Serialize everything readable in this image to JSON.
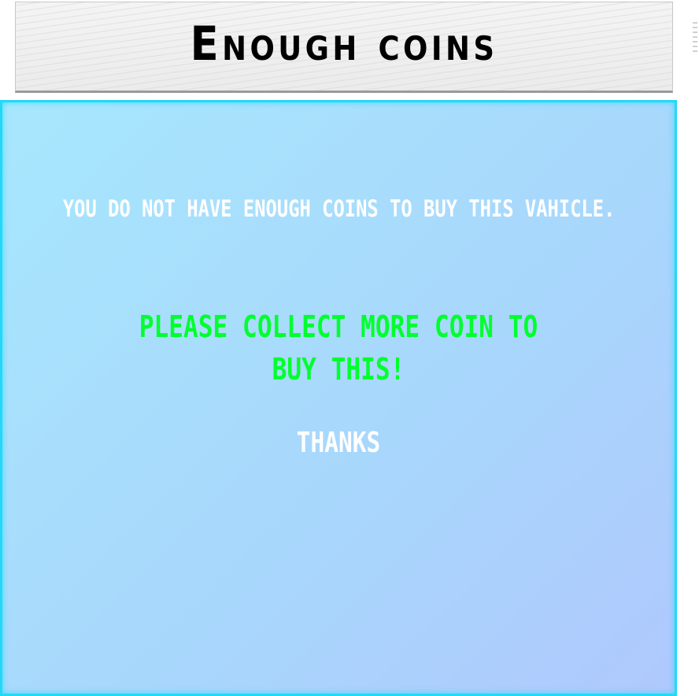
{
  "header": {
    "title": "Enough coins"
  },
  "dialog": {
    "message": "YOU DO NOT HAVE ENOUGH COINS TO BUY THIS VAHICLE.",
    "please_line1": "PLEASE COLLECT MORE COIN TO",
    "please_line2": "BUY THIS!",
    "thanks": "THANKS"
  },
  "colors": {
    "header_text": "#000000",
    "panel_border": "#22d8f8",
    "message_text": "#ffffff",
    "highlight_text": "#00ff2e"
  }
}
